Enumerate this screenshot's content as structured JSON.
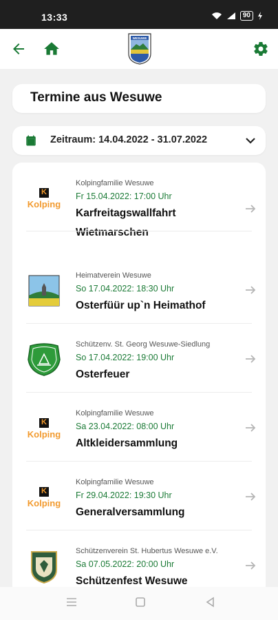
{
  "statusbar": {
    "time": "13:33",
    "battery": "90"
  },
  "header": {
    "title": "Termine aus Wesuwe"
  },
  "filter": {
    "range_label": "Zeitraum: 14.04.2022 - 31.07.2022"
  },
  "crest": {
    "text": "WESUWE"
  },
  "events": [
    {
      "org": "Kolpingfamilie Wesuwe",
      "date": "Fr 15.04.2022: 17:00 Uhr",
      "name": "Karfreitagswallfahrt Wietmarschen",
      "logo": "kolping-logo",
      "logo_text": "Kolping"
    },
    {
      "org": "Heimatverein Wesuwe",
      "date": "So 17.04.2022: 18:30 Uhr",
      "name": "Osterfüür up`n Heimathof",
      "logo": "heimatverein-logo"
    },
    {
      "org": "Schützenv. St. Georg Wesuwe-Siedlung",
      "date": "So 17.04.2022: 19:00 Uhr",
      "name": "Osterfeuer",
      "logo": "st-georg-logo"
    },
    {
      "org": "Kolpingfamilie Wesuwe",
      "date": "Sa 23.04.2022: 08:00 Uhr",
      "name": "Altkleidersammlung",
      "logo": "kolping-logo",
      "logo_text": "Kolping"
    },
    {
      "org": "Kolpingfamilie Wesuwe",
      "date": "Fr 29.04.2022: 19:30 Uhr",
      "name": "Generalversammlung",
      "logo": "kolping-logo",
      "logo_text": "Kolping"
    },
    {
      "org": "Schützenverein St. Hubertus Wesuwe e.V.",
      "date": "Sa 07.05.2022: 20:00 Uhr",
      "name": "Schützenfest Wesuwe",
      "logo": "st-hubertus-logo"
    }
  ],
  "colors": {
    "accent": "#1a7a35",
    "kolping": "#f29a2e",
    "status_bar": "#1f1f1f"
  },
  "icons": [
    "back-arrow-icon",
    "home-icon",
    "settings-icon",
    "calendar-icon",
    "chevron-down-icon",
    "arrow-right-icon"
  ]
}
